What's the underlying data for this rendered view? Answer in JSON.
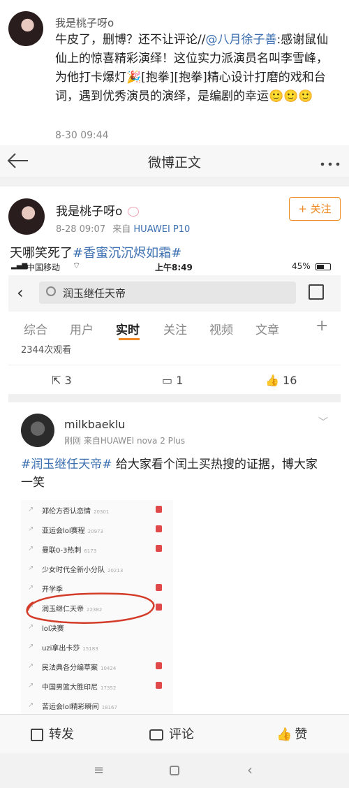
{
  "first_comment": {
    "username": "我是桃子呀o",
    "text_before": "牛皮了，删博？还不让评论//",
    "mention": "@八月徐子善",
    "text_after": ":感谢鼠仙仙上的惊喜精彩演绎！这位实力派演员名叫李雪峰，为他打卡爆灯🎉[抱拳][抱拳]精心设计打磨的戏和台词，遇到优秀演员的演绎，是编剧的幸运🙂🙂🙂",
    "timestamp": "8-30 09:44"
  },
  "nav": {
    "back_icon": "arrow-left-icon",
    "title": "微博正文",
    "more_icon": "more-dots-icon"
  },
  "post": {
    "username": "我是桃子呀o",
    "badge_icon": "rabbit-icon",
    "time": "8-28 09:07",
    "source_prefix": "来自",
    "source": "HUAWEI P10",
    "follow_label": "+ 关注",
    "text": "天哪笑死了",
    "hashtag": "#香蜜沉沉烬如霜#"
  },
  "embedded": {
    "status_bar": {
      "carrier": "中国移动",
      "time": "上午8:49",
      "battery": "45%"
    },
    "search_query": "润玉继任天帝",
    "tabs": [
      "综合",
      "用户",
      "实时",
      "关注",
      "视频",
      "文章"
    ],
    "active_tab": "实时",
    "plus_icon": "plus-icon",
    "view_count": "2344次观看",
    "actions": {
      "reposts": "3",
      "comments": "1",
      "likes": "16"
    },
    "inner_post": {
      "username": "milkbaeklu",
      "meta": "刚刚 来自HUAWEI nova 2 Plus",
      "hashtag": "#润玉继任天帝#",
      "text": "给大家看个闰土买热搜的证据，博大家一笑"
    },
    "hot_list": [
      {
        "title": "郑伦方否认恋情",
        "count": "20301",
        "badge": true
      },
      {
        "title": "亚运会lol赛程",
        "count": "20973",
        "badge": true
      },
      {
        "title": "曼联0-3热刺",
        "count": "6173",
        "badge": true
      },
      {
        "title": "少女时代全新小分队",
        "count": "20213",
        "badge": false
      },
      {
        "title": "开学季",
        "count": "",
        "badge": true
      },
      {
        "title": "润玉继仁天帝",
        "count": "22382",
        "badge": true
      },
      {
        "title": "lol决赛",
        "count": "",
        "badge": false
      },
      {
        "title": "uzi拿出卡莎",
        "count": "15183",
        "badge": false
      },
      {
        "title": "民法典各分编草案",
        "count": "10424",
        "badge": true
      },
      {
        "title": "中国男篮大胜印尼",
        "count": "17352",
        "badge": true
      },
      {
        "title": "苦运会lol精彩瞬间",
        "count": "18167",
        "badge": false
      }
    ]
  },
  "bottom_bar": {
    "repost": "转发",
    "comment": "评论",
    "like": "赞"
  },
  "colors": {
    "link": "#3b6fb0",
    "follow": "#f08a24",
    "circle": "#d43c2a"
  }
}
